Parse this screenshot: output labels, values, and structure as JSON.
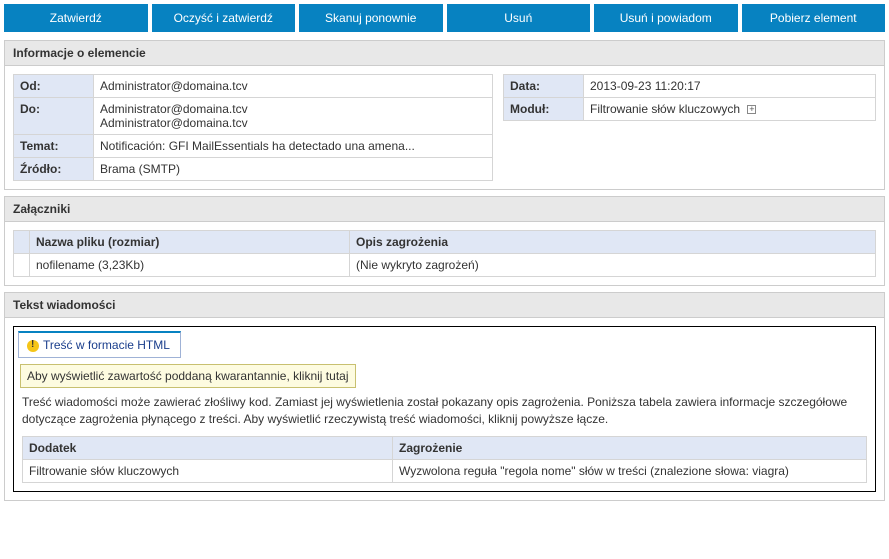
{
  "toolbar": {
    "approve": "Zatwierdź",
    "clean_approve": "Oczyść i zatwierdź",
    "rescan": "Skanuj ponownie",
    "delete": "Usuń",
    "delete_notify": "Usuń i powiadom",
    "download": "Pobierz element"
  },
  "item_info": {
    "header": "Informacje o elemencie",
    "from_label": "Od:",
    "from_value": "Administrator@domaina.tcv",
    "to_label": "Do:",
    "to_value1": "Administrator@domaina.tcv",
    "to_value2": "Administrator@domaina.tcv",
    "subject_label": "Temat:",
    "subject_value": "Notificación: GFI MailEssentials ha detectado una amena...",
    "source_label": "Źródło:",
    "source_value": "Brama (SMTP)",
    "date_label": "Data:",
    "date_value": "2013-09-23 11:20:17",
    "module_label": "Moduł:",
    "module_value": "Filtrowanie słów kluczowych"
  },
  "attachments": {
    "header": "Załączniki",
    "col_file": "Nazwa pliku (rozmiar)",
    "col_threat": "Opis zagrożenia",
    "row_file": "nofilename (3,23Kb)",
    "row_threat": "(Nie wykryto zagrożeń)"
  },
  "message": {
    "header": "Tekst wiadomości",
    "tab_label": "Treść w formacie HTML",
    "quarantine_link": "Aby wyświetlić zawartość poddaną kwarantannie, kliknij tutaj",
    "body_text": "Treść wiadomości może zawierać złośliwy kod. Zamiast jej wyświetlenia został pokazany opis zagrożenia. Poniższa tabela zawiera informacje szczegółowe dotyczące zagrożenia płynącego z treści. Aby wyświetlić rzeczywistą treść  wiadomości, kliknij powyższe łącze.",
    "col_addon": "Dodatek",
    "col_threat": "Zagrożenie",
    "row_addon": "Filtrowanie słów kluczowych",
    "row_threat": "Wyzwolona reguła \"regola nome\" słów w treści (znalezione słowa: viagra)"
  }
}
